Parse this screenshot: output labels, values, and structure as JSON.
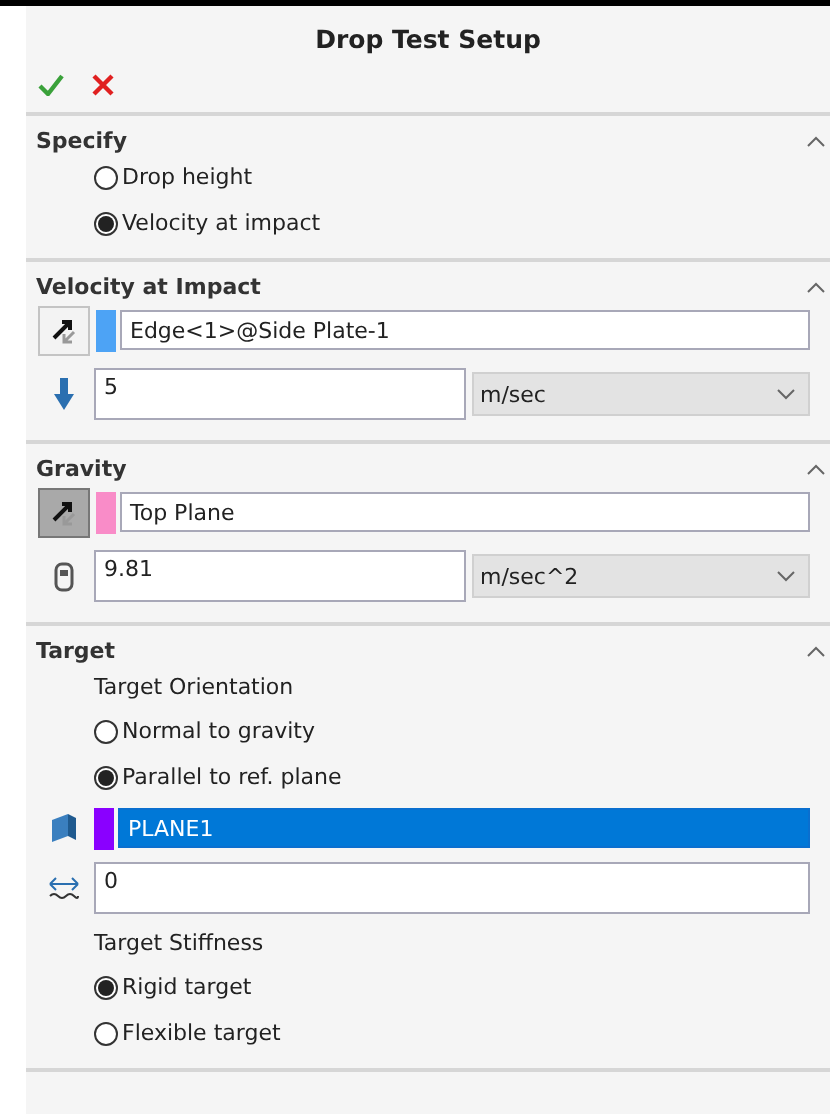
{
  "title": "Drop Test Setup",
  "sections": [
    {
      "title": "Specify",
      "expanded": true,
      "items": [
        {
          "kind": "radio",
          "label": "Drop height",
          "selected": false
        },
        {
          "kind": "radio",
          "label": "Velocity at impact",
          "selected": true
        }
      ]
    },
    {
      "title": "Velocity at Impact",
      "expanded": true,
      "items": [
        {
          "kind": "direction",
          "pressed": false,
          "color": "#4da3f5",
          "value": "Edge<1>@Side Plate-1",
          "selected": false
        },
        {
          "kind": "velocity",
          "value": "5",
          "unit": "m/sec"
        }
      ]
    },
    {
      "title": "Gravity",
      "expanded": true,
      "items": [
        {
          "kind": "direction",
          "pressed": true,
          "color": "#f98cc8",
          "value": "Top Plane",
          "selected": false
        },
        {
          "kind": "gravity",
          "value": "9.81",
          "unit": "m/sec^2"
        }
      ]
    },
    {
      "title": "Target",
      "expanded": true,
      "items": [
        {
          "kind": "label",
          "label": "Target Orientation"
        },
        {
          "kind": "radio",
          "label": "Normal to gravity",
          "selected": false
        },
        {
          "kind": "radio",
          "label": "Parallel to ref. plane",
          "selected": true
        },
        {
          "kind": "plane",
          "color": "#8a00ff",
          "value": "PLANE1",
          "selected": true
        },
        {
          "kind": "offset",
          "value": "0"
        },
        {
          "kind": "label",
          "label": "Target Stiffness"
        },
        {
          "kind": "radio",
          "label": "Rigid target",
          "selected": true
        },
        {
          "kind": "radio",
          "label": "Flexible target",
          "selected": false
        }
      ]
    }
  ]
}
